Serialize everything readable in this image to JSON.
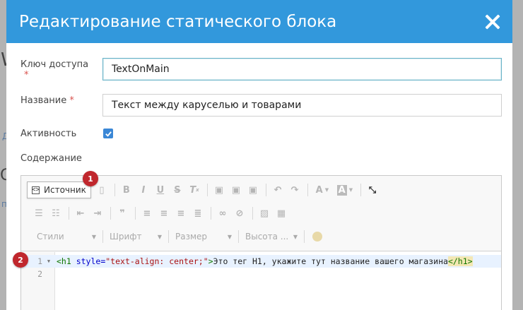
{
  "background": {
    "fragments": [
      "W",
      "Д",
      "С",
      "п"
    ]
  },
  "modal": {
    "title": "Редактирование статического блока",
    "close_icon": "close-icon"
  },
  "form": {
    "access_key": {
      "label": "Ключ доступа",
      "required_mark": "*",
      "value": "TextOnMain"
    },
    "name": {
      "label": "Название",
      "required_mark": "*",
      "value": "Текст между каруселью и товарами"
    },
    "active": {
      "label": "Активность",
      "checked": true
    },
    "content": {
      "label": "Содержание"
    }
  },
  "editor": {
    "source_button": "Источник",
    "toolbar_icons_row1": [
      "copy-format-icon",
      "bold-icon",
      "italic-icon",
      "underline-icon",
      "strike-icon",
      "clear-format-icon",
      "paste-icon",
      "paste-text-icon",
      "paste-word-icon",
      "undo-icon",
      "redo-icon",
      "text-color-icon",
      "bg-color-icon",
      "maximize-icon"
    ],
    "toolbar_icons_row2": [
      "numbered-list-icon",
      "bulleted-list-icon",
      "outdent-icon",
      "indent-icon",
      "blockquote-icon",
      "align-left-icon",
      "align-center-icon",
      "align-right-icon",
      "justify-icon",
      "link-icon",
      "unlink-icon",
      "image-icon",
      "table-icon"
    ],
    "combos": [
      "Стили",
      "Шрифт",
      "Размер",
      "Высота ..."
    ],
    "emoji_icon": "smiley-icon",
    "lines": [
      {
        "number": "1",
        "parts": [
          {
            "cls": "tag",
            "text": "<h1"
          },
          {
            "cls": "attr",
            "text": " style="
          },
          {
            "cls": "str",
            "text": "\"text-align: center;\""
          },
          {
            "cls": "tag",
            "text": ">"
          },
          {
            "cls": "txt",
            "text": "Это тег H1, укажите тут название вашего магазина"
          },
          {
            "cls": "tag tag-hl",
            "text": "</h1>"
          }
        ]
      },
      {
        "number": "2",
        "parts": []
      }
    ]
  },
  "badges": [
    "1",
    "2"
  ],
  "colors": {
    "header": "#3298dc",
    "badge": "#c0272d",
    "checkbox": "#3a87d6"
  }
}
